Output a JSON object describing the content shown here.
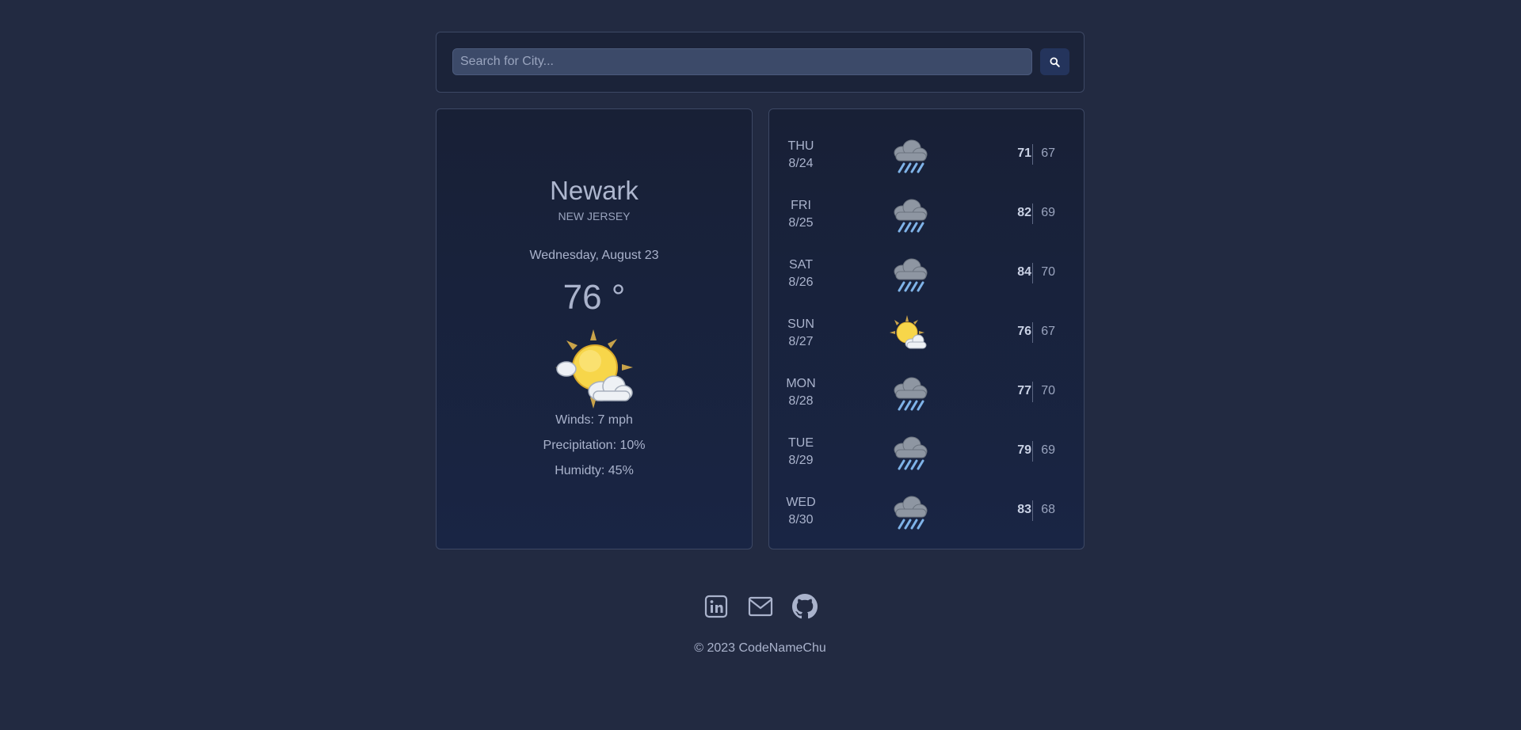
{
  "search": {
    "placeholder": "Search for City..."
  },
  "current": {
    "city": "Newark",
    "state": "NEW JERSEY",
    "date": "Wednesday, August 23",
    "temp": "76 °",
    "icon": "partly-sunny-icon",
    "winds": "Winds: 7 mph",
    "precipitation": "Precipitation: 10%",
    "humidity": "Humidty: 45%"
  },
  "forecast": [
    {
      "day": "THU",
      "date": "8/24",
      "hi": "71",
      "lo": "67",
      "icon": "rain-cloud-icon"
    },
    {
      "day": "FRI",
      "date": "8/25",
      "hi": "82",
      "lo": "69",
      "icon": "rain-cloud-icon"
    },
    {
      "day": "SAT",
      "date": "8/26",
      "hi": "84",
      "lo": "70",
      "icon": "rain-cloud-icon"
    },
    {
      "day": "SUN",
      "date": "8/27",
      "hi": "76",
      "lo": "67",
      "icon": "partly-sunny-icon"
    },
    {
      "day": "MON",
      "date": "8/28",
      "hi": "77",
      "lo": "70",
      "icon": "rain-cloud-icon"
    },
    {
      "day": "TUE",
      "date": "8/29",
      "hi": "79",
      "lo": "69",
      "icon": "rain-cloud-icon"
    },
    {
      "day": "WED",
      "date": "8/30",
      "hi": "83",
      "lo": "68",
      "icon": "rain-cloud-icon"
    }
  ],
  "footer": {
    "links": [
      "linkedin-icon",
      "mail-icon",
      "github-icon"
    ],
    "copyright": "© 2023 CodeNameChu"
  },
  "colors": {
    "background": "#222a41",
    "card": "#1b2339",
    "accent": "#24345c"
  }
}
